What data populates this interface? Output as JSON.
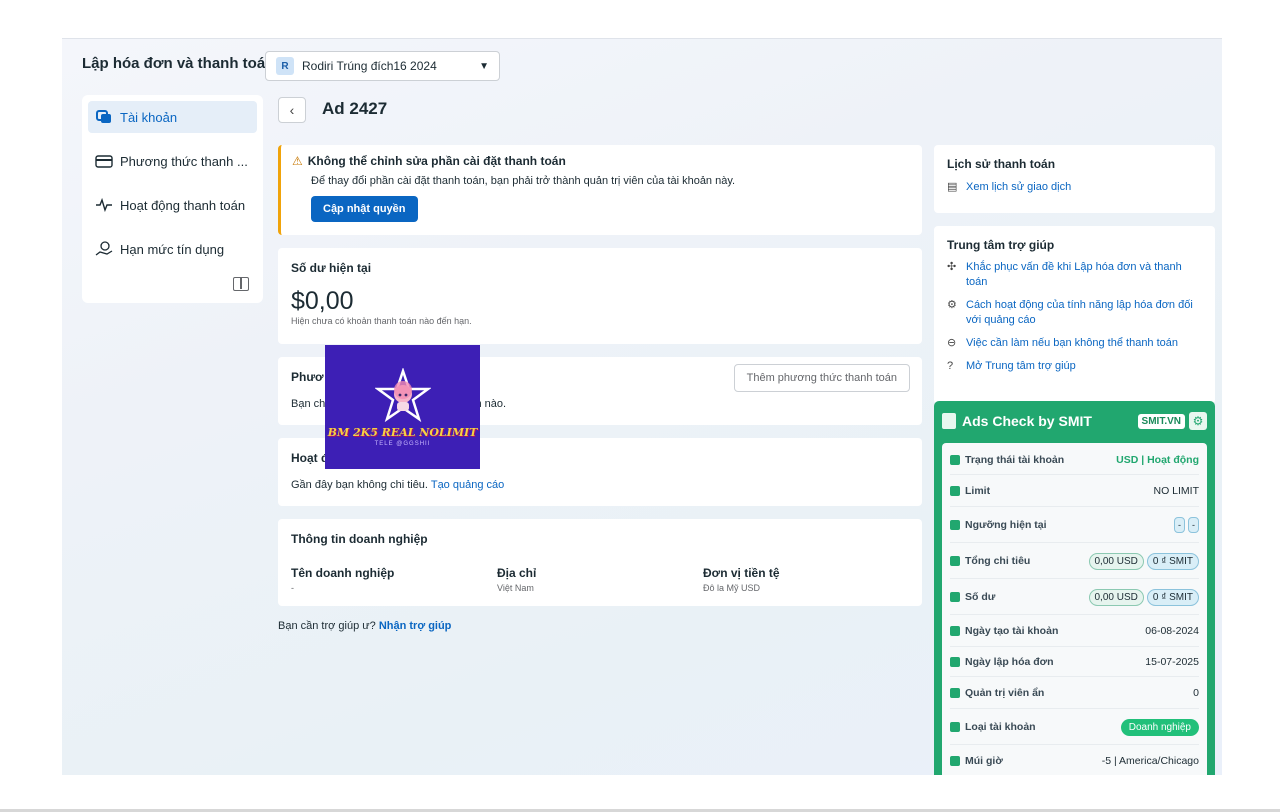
{
  "header": {
    "page_title": "Lập hóa đơn và thanh toán",
    "account_initial": "R",
    "account_name": "Rodiri Trúng đích16 2024"
  },
  "sidebar": {
    "items": [
      {
        "label": "Tài khoản",
        "icon": "accounts-icon"
      },
      {
        "label": "Phương thức thanh ...",
        "icon": "credit-card-icon"
      },
      {
        "label": "Hoạt động thanh toán",
        "icon": "activity-pulse-icon"
      },
      {
        "label": "Hạn mức tín dụng",
        "icon": "credit-limit-icon"
      }
    ]
  },
  "main": {
    "ad_title": "Ad 2427",
    "warning": {
      "title": "Không thể chỉnh sửa phần cài đặt thanh toán",
      "text": "Để thay đổi phần cài đặt thanh toán, bạn phải trở thành quản trị viên của tài khoản này.",
      "button": "Cập nhật quyền"
    },
    "balance": {
      "title": "Số dư hiện tại",
      "value": "$0,00",
      "note": "Hiện chưa có khoản thanh toán nào đến hạn."
    },
    "payment_methods": {
      "title_visible": "Phươ",
      "text_start": "Bạn ch",
      "text_end": "ần nào.",
      "add_button": "Thêm phương thức thanh toán"
    },
    "activity": {
      "title_visible": "Hoạt đ",
      "text": "Gần đây bạn không chi tiêu.",
      "link": "Tạo quảng cáo"
    },
    "business": {
      "title": "Thông tin doanh nghiệp",
      "columns": [
        {
          "label": "Tên doanh nghiệp",
          "value": "-"
        },
        {
          "label": "Địa chỉ",
          "value": "Việt Nam"
        },
        {
          "label": "Đơn vị tiền tệ",
          "value": "Đô la Mỹ USD"
        }
      ]
    },
    "help": {
      "text": "Bạn cần trợ giúp ư?",
      "link": "Nhận trợ giúp"
    }
  },
  "right": {
    "history": {
      "title": "Lịch sử thanh toán",
      "link": "Xem lịch sử giao dịch"
    },
    "help_center": {
      "title": "Trung tâm trợ giúp",
      "links": [
        "Khắc phục vấn đề khi Lập hóa đơn và thanh toán",
        "Cách hoạt động của tính năng lập hóa đơn đối với quảng cáo",
        "Việc cần làm nếu bạn không thể thanh toán",
        "Mở Trung tâm trợ giúp"
      ]
    }
  },
  "smit": {
    "title": "Ads Check by SMIT",
    "badge": "SMIT.VN",
    "rows": [
      {
        "label": "Trạng thái tài khoản",
        "value": "USD | Hoạt động"
      },
      {
        "label": "Limit",
        "value": "NO LIMIT"
      },
      {
        "label": "Ngưỡng hiện tại",
        "value": "-"
      },
      {
        "label": "Tổng chi tiêu",
        "value1": "0,00 USD",
        "value2": "0 ₫ SMIT"
      },
      {
        "label": "Số dư",
        "value1": "0,00 USD",
        "value2": "0 ₫ SMIT"
      },
      {
        "label": "Ngày tạo tài khoản",
        "value": "06-08-2024"
      },
      {
        "label": "Ngày lập hóa đơn",
        "value": "15-07-2025"
      },
      {
        "label": "Quản trị viên ẩn",
        "value": "0"
      },
      {
        "label": "Loại tài khoản",
        "value": "Doanh nghiệp"
      },
      {
        "label": "Múi giờ",
        "value": "-5 | America/Chicago"
      }
    ]
  },
  "overlay": {
    "brand": "BM 2K5 REAL NOLIMIT",
    "sub": "TELE @GGSHII"
  },
  "colors": {
    "primary": "#0a66c2",
    "warning": "#f0a30a",
    "smit_green": "#21a76f",
    "overlay_bg": "#3d1fb5"
  }
}
